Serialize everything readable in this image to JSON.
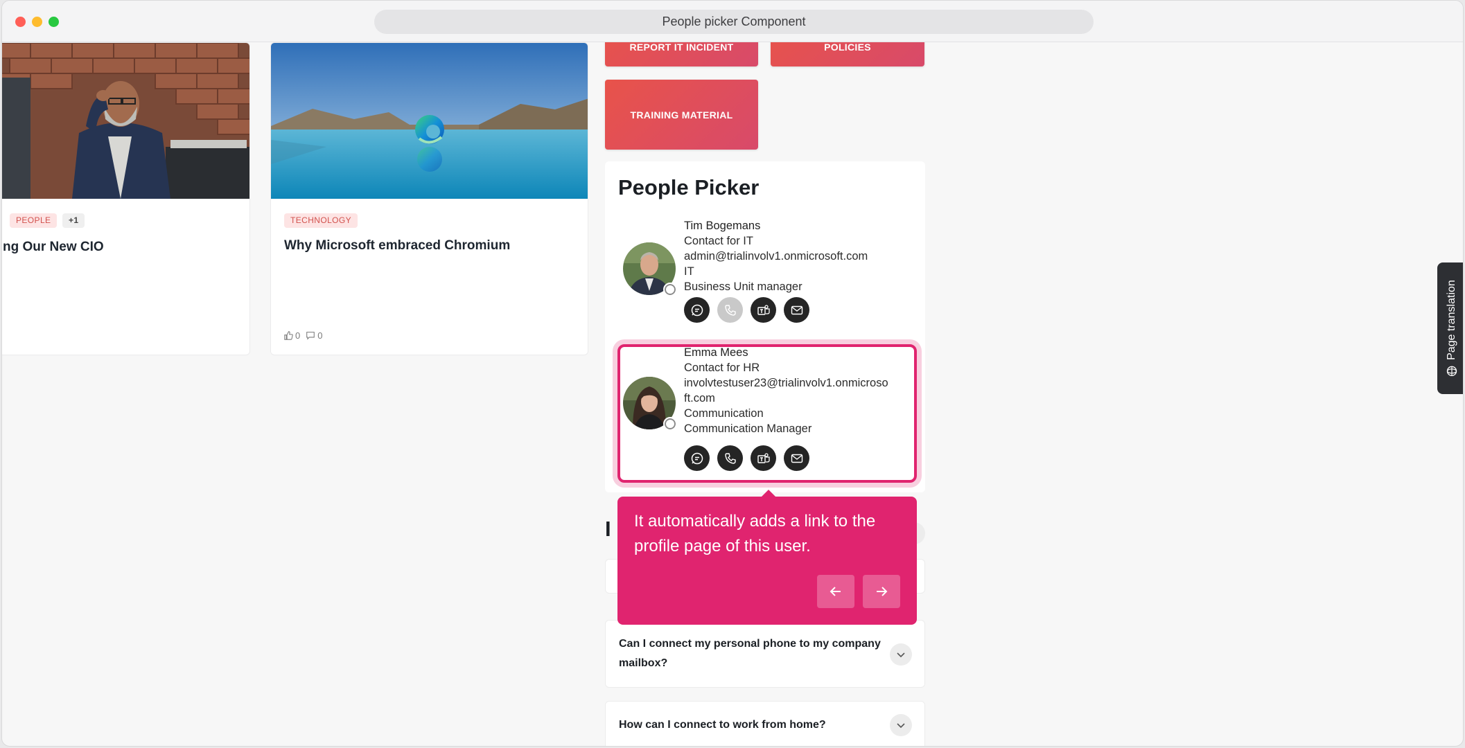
{
  "window": {
    "title": "People picker Component"
  },
  "news": [
    {
      "tags": [
        "PEOPLE",
        "+1"
      ],
      "title": "ng Our New CIO"
    },
    {
      "tags": [
        "TECHNOLOGY"
      ],
      "title": "Why Microsoft embraced Chromium",
      "likes": "0",
      "comments": "0"
    }
  ],
  "tiles": [
    "REPORT IT INCIDENT",
    "POLICIES",
    "TRAINING MATERIAL"
  ],
  "people_picker": {
    "title": "People Picker",
    "people": [
      {
        "name": "Tim Bogemans",
        "role": "Contact for IT",
        "email": "admin@trialinvolv1.onmicrosoft.com",
        "department": "IT",
        "job_title": "Business Unit manager",
        "actions": [
          "chat-icon",
          "phone-icon",
          "teams-icon",
          "mail-icon"
        ]
      },
      {
        "name": "Emma Mees",
        "role": "Contact for HR",
        "email": "involvtestuser23@trialinvolv1.onmicroso ft.com",
        "email_line1": "involvtestuser23@trialinvolv1.onmicroso",
        "email_line2": "ft.com",
        "department": "Communication",
        "job_title": "Communication Manager",
        "actions": [
          "chat-icon",
          "phone-icon",
          "teams-icon",
          "mail-icon"
        ]
      }
    ]
  },
  "tooltip": {
    "text": "It automatically adds a link to the profile page of this user.",
    "prev_icon": "arrow-left-icon",
    "next_icon": "arrow-right-icon"
  },
  "faq": {
    "heading": "I",
    "items": [
      "",
      "Can I connect my personal phone to my company mailbox?",
      "How can I connect to work from home?"
    ]
  },
  "side_tab": {
    "label": "Page translation"
  },
  "colors": {
    "accent": "#e0246f",
    "tile": "#e8534a",
    "tag_bg": "#fde4e4",
    "tag_text": "#d2514d"
  }
}
